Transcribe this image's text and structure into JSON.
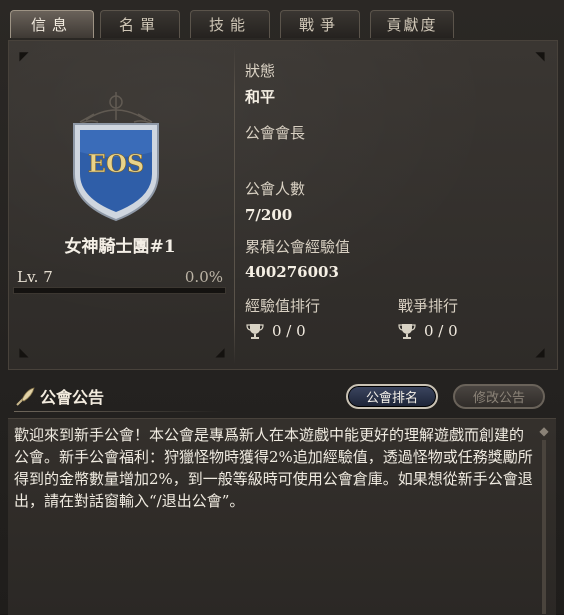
{
  "tabs": [
    {
      "label": "信息",
      "active": true
    },
    {
      "label": "名單",
      "active": false
    },
    {
      "label": "技能",
      "active": false
    },
    {
      "label": "戰爭",
      "active": false
    },
    {
      "label": "貢獻度",
      "active": false
    }
  ],
  "guild": {
    "emblem_text": "EOS",
    "name": "女神騎士團#1",
    "level": "Lv. 7",
    "exp_percent": "0.0%",
    "exp_fraction": 0.0
  },
  "stats": {
    "status_label": "狀態",
    "status_value": "和平",
    "leader_label": "公會會長",
    "leader_value": "",
    "members_label": "公會人數",
    "members_value": "7/200",
    "exp_total_label": "累積公會經驗值",
    "exp_total_value": "400276003",
    "exp_rank_label": "經驗值排行",
    "exp_rank_value": "0 / 0",
    "war_rank_label": "戰爭排行",
    "war_rank_value": "0 / 0"
  },
  "announcement": {
    "title": "公會公告",
    "rank_button": "公會排名",
    "edit_button": "修改公告",
    "text": "歡迎來到新手公會！本公會是專爲新人在本遊戲中能更好的理解遊戲而創建的公會。新手公會福利：狩獵怪物時獲得2%追加經驗值，透過怪物或任務獎勵所得到的金幣數量增加2%，到一般等級時可使用公會倉庫。如果想從新手公會退出，請在對話窗輸入“/退出公會”。"
  },
  "colors": {
    "accent_gold": "#c8a44a",
    "shield_blue": "#2f5ea8",
    "rank_button_bg": "#1c2336"
  }
}
